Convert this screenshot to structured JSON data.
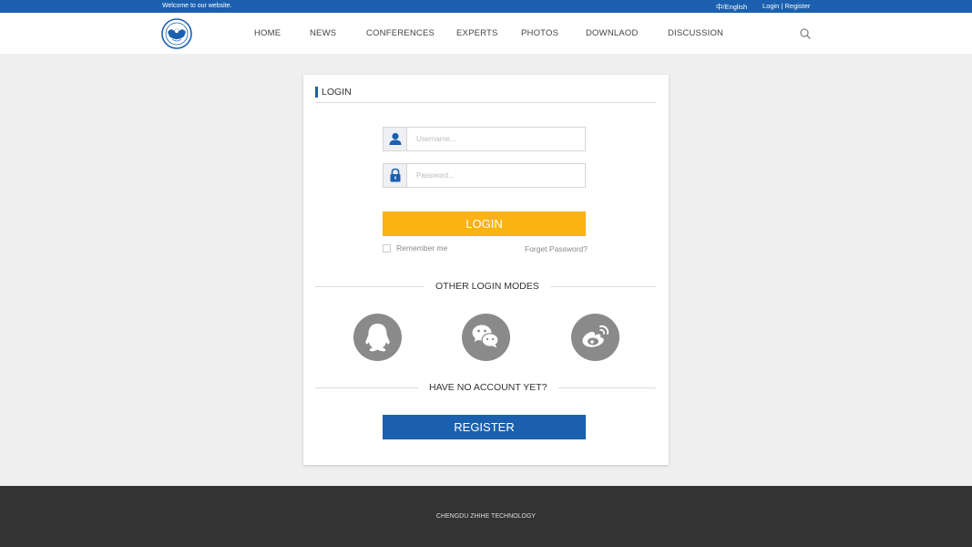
{
  "topbar": {
    "welcome": "Welcome to our website.",
    "lang": "中/English",
    "login": "Login",
    "separator": "|",
    "register": "Register"
  },
  "nav": {
    "items": [
      "HOME",
      "NEWS",
      "CONFERENCES",
      "EXPERTS",
      "PHOTOS",
      "DOWNLAOD",
      "DISCUSSION"
    ]
  },
  "login": {
    "title": "LOGIN",
    "username_placeholder": "Username...",
    "password_placeholder": "Password...",
    "button": "LOGIN",
    "remember": "Remember me",
    "forgot": "Forget Password?",
    "other_modes": "OTHER LOGIN MODES",
    "no_account": "HAVE NO ACCOUNT YET?",
    "register_button": "REGISTER"
  },
  "icons": {
    "user": "user-icon",
    "lock": "lock-icon",
    "search": "search-icon",
    "qq": "qq-icon",
    "wechat": "wechat-icon",
    "weibo": "weibo-icon"
  },
  "colors": {
    "brand_blue": "#1a60ae",
    "login_yellow": "#fbb312",
    "social_gray": "#8a8a8a",
    "footer_bg": "#333333"
  },
  "footer": {
    "text": "CHENGDU ZHIHE TECHNOLOGY"
  }
}
